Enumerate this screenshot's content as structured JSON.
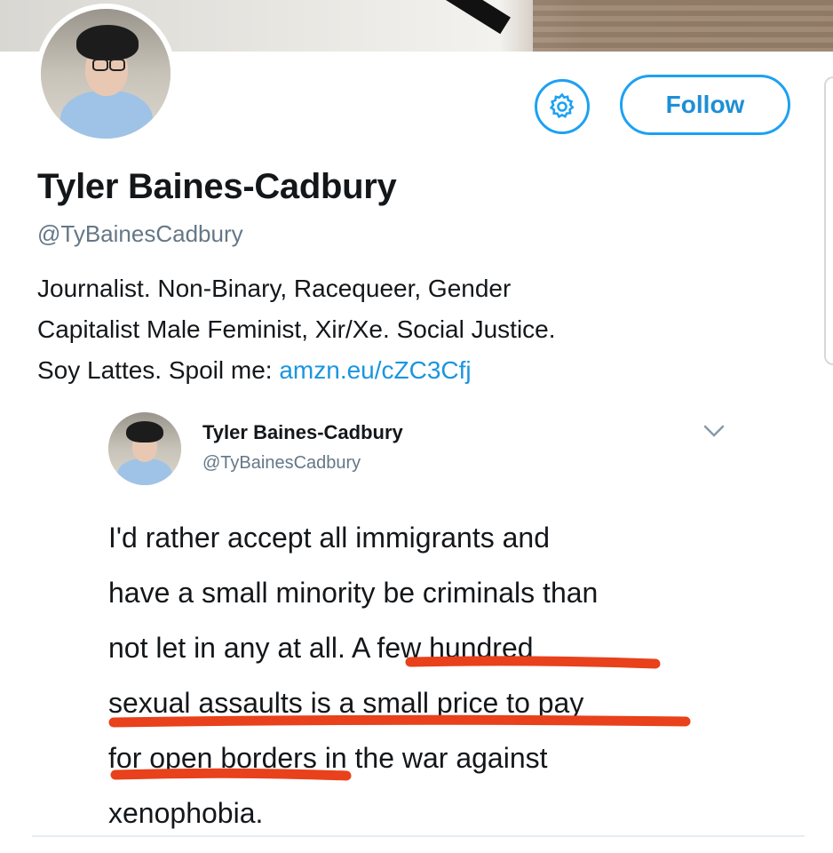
{
  "colors": {
    "accent": "#1da1f2",
    "link": "#1b95e0",
    "muted": "#657786",
    "highlight": "#e8411b"
  },
  "profile": {
    "name": "Tyler Baines-Cadbury",
    "handle": "@TyBainesCadbury",
    "bio_line1": "Journalist. Non-Binary, Racequeer, Gender",
    "bio_line2": "Capitalist Male Feminist, Xir/Xe. Social Justice.",
    "bio_line3_prefix": "Soy Lattes. Spoil me: ",
    "bio_link": "amzn.eu/cZC3Cfj",
    "avatar_icon": "profile-photo"
  },
  "actions": {
    "settings_icon": "gear-icon",
    "follow_label": "Follow"
  },
  "tweet": {
    "author_name": "Tyler Baines-Cadbury",
    "author_handle": "@TyBainesCadbury",
    "menu_icon": "chevron-down-icon",
    "lines": [
      "I'd rather accept all immigrants and",
      "have a small minority be criminals than",
      "not let in any at all. A few hundred",
      "sexual assaults is a small price to pay",
      "for open borders in the war against",
      "xenophobia."
    ]
  }
}
